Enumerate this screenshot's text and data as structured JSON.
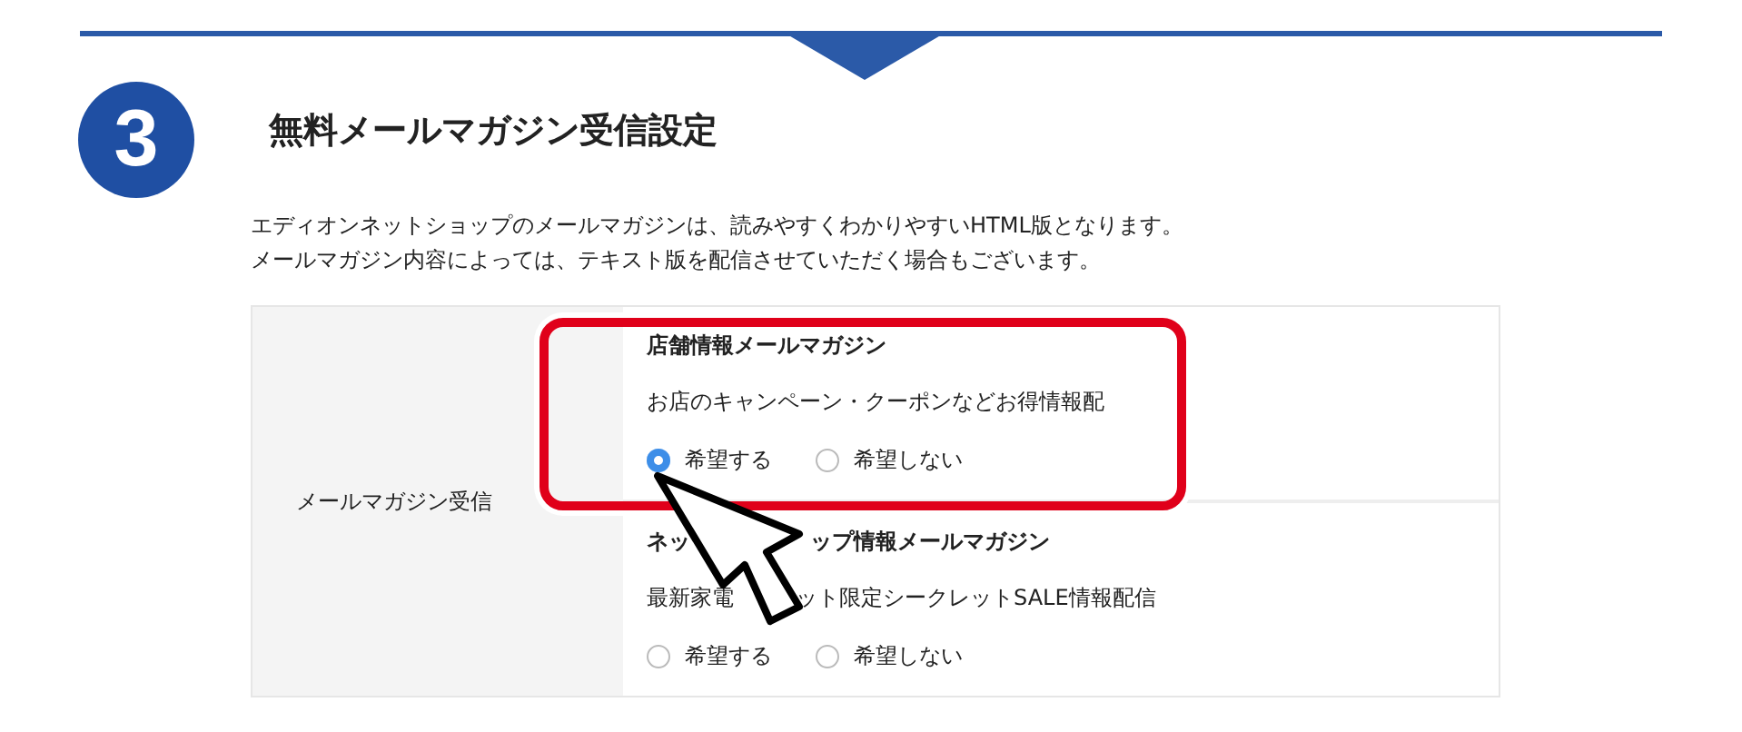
{
  "step_number": "3",
  "title": "無料メールマガジン受信設定",
  "intro": [
    "エディオンネットショップのメールマガジンは、読みやすくわかりやすいHTML版となります。",
    "メールマガジン内容によっては、テキスト版を配信させていただく場合もございます。"
  ],
  "setting": {
    "label": "メールマガジン受信",
    "newsletters": [
      {
        "title_parts": [
          "店舗情報メールマガジン"
        ],
        "description_parts": [
          "お店のキャンペーン・クーポンなどお得情報配"
        ],
        "highlighted": true,
        "options": [
          {
            "label": "希望する",
            "selected": true
          },
          {
            "label": "希望しない",
            "selected": false
          }
        ]
      },
      {
        "title_parts": [
          "ネッ",
          "ップ情報メールマガジン"
        ],
        "description_parts": [
          "最新家電",
          "ット限定シークレットSALE情報配信"
        ],
        "highlighted": false,
        "options": [
          {
            "label": "希望する",
            "selected": false
          },
          {
            "label": "希望しない",
            "selected": false
          }
        ]
      }
    ]
  }
}
